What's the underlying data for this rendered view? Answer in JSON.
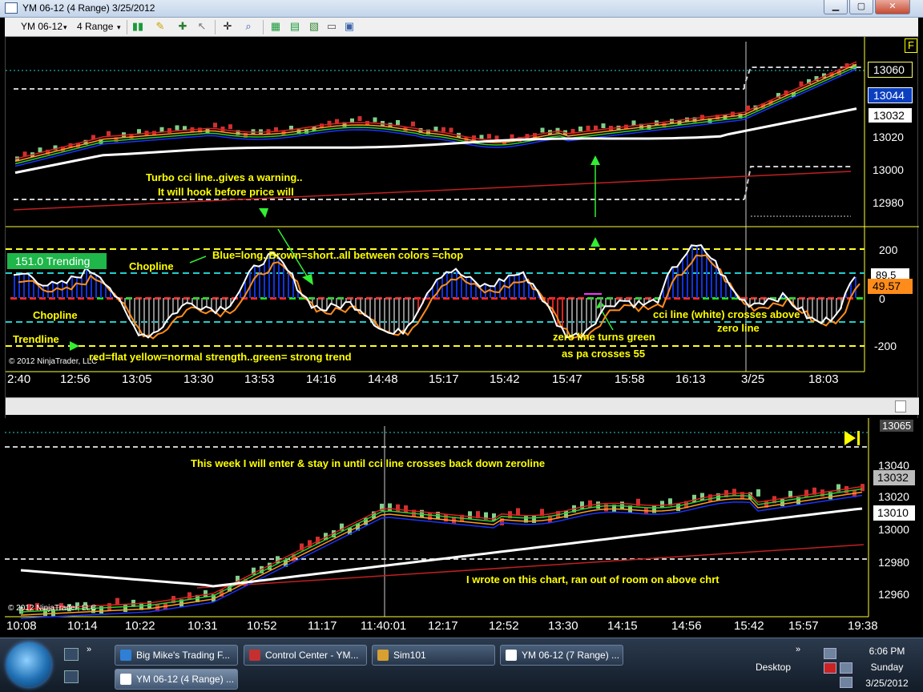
{
  "window": {
    "title": "YM 06-12 (4 Range)  3/25/2012"
  },
  "toolbar": {
    "instrument": "YM 06-12",
    "interval": "4 Range"
  },
  "top_chart": {
    "price_ticks": [
      "13060",
      "13020",
      "13000",
      "12980"
    ],
    "price_flags": {
      "last": "13060",
      "blue": "13044",
      "white": "13032"
    },
    "time_labels": [
      "2:40",
      "12:56",
      "13:05",
      "13:30",
      "13:53",
      "14:16",
      "14:48",
      "15:17",
      "15:42",
      "15:47",
      "15:58",
      "16:13",
      "3/25",
      "18:03"
    ],
    "indicator_ticks": [
      "200",
      "0",
      "-200"
    ],
    "cci_flags": {
      "white": "89.5",
      "orange": "49.57"
    },
    "trend_label": "151.0 Trending",
    "copyright": "© 2012 NinjaTrader, LLC",
    "corner_flag": "F",
    "annotations": {
      "turbo": "Turbo cci line..gives a warning..",
      "hook": "It will hook before price will",
      "blue_long": "Blue=long..Brown=short..all between colors =chop",
      "chopline1": "Chopline",
      "chopline2": "Chopline",
      "trendline": "Trendline",
      "red_flat": "red=flat  yellow=normal strength..green= strong trend",
      "zero_green": "zero line turns green",
      "pa_crosses": "as pa crosses 55",
      "cci_white": "cci line (white) crosses above",
      "zero_line": "zero line"
    }
  },
  "bottom_chart": {
    "price_ticks": [
      "13065",
      "13040",
      "13020",
      "13000",
      "12980",
      "12960"
    ],
    "price_flags": {
      "upper": "13032",
      "lower": "13010"
    },
    "time_labels": [
      "10:08",
      "10:14",
      "10:22",
      "10:31",
      "10:52",
      "11:17",
      "11:40:01",
      "12:17",
      "12:52",
      "13:30",
      "14:15",
      "14:56",
      "15:42",
      "15:57",
      "19:38"
    ],
    "copyright": "© 2012 NinjaTrader, LLC",
    "annotations": {
      "week": "This week I will enter & stay in until cci line crosses back down zeroline",
      "wrote": "I wrote on this chart, ran out of room on above chrt"
    }
  },
  "taskbar": {
    "tasks": [
      "Big Mike's Trading F...",
      "Control Center - YM...",
      "Sim101",
      "YM 06-12 (7 Range) ...",
      "YM 06-12 (4 Range) ..."
    ],
    "desktop": "Desktop",
    "time": "6:06 PM",
    "day": "Sunday",
    "date": "3/25/2012"
  },
  "colors": {
    "annotation": "#ffff00",
    "cci_white": "#ffffff",
    "cci_orange": "#ff8c1a",
    "up_bar": "#7fd08a",
    "down_bar": "#d03030",
    "accent_blue": "#0b3fbf"
  }
}
